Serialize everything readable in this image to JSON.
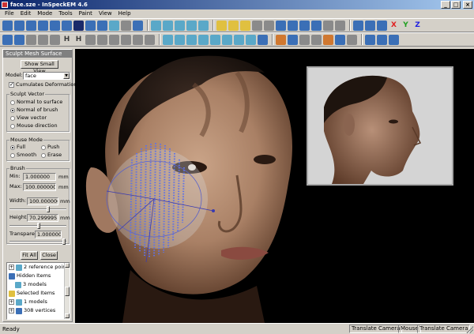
{
  "window": {
    "title": "face.sze - InSpeckEM 4.6"
  },
  "menu": [
    "File",
    "Edit",
    "Mode",
    "Tools",
    "Paint",
    "View",
    "Help"
  ],
  "toolbar1": {
    "axes": {
      "x": "X",
      "y": "Y",
      "z": "Z"
    },
    "axis_colors": {
      "x": "#e02020",
      "y": "#20a020",
      "z": "#2020e0"
    }
  },
  "toolbar2": {
    "h1": "H",
    "h2": "H"
  },
  "panel": {
    "title": "Sculpt Mesh Surface",
    "show_small_view": "Show Small View",
    "model_label": "Model:",
    "model_value": "face",
    "cumulates_deformation": "Cumulates Deformation",
    "sculpt_vector": {
      "title": "Sculpt Vector",
      "options": [
        "Normal to surface",
        "Normal of brush",
        "View vector",
        "Mouse direction"
      ],
      "selected_index": 1
    },
    "mouse_mode": {
      "title": "Mouse Mode",
      "options": [
        "Full",
        "Push",
        "Smooth",
        "Erase"
      ],
      "selected_index": 0
    },
    "brush": {
      "title": "Brush",
      "min_label": "Min:",
      "min_value": "1.000000",
      "min_unit": "mm",
      "max_label": "Max:",
      "max_value": "100.000000",
      "max_unit": "mm",
      "width_label": "Width:",
      "width_value": "100.000000",
      "width_unit": "mm",
      "height_label": "Height:",
      "height_value": "70.299995",
      "height_unit": "mm",
      "transparency_label": "Transparency:",
      "transparency_value": "1.000000"
    },
    "fit_all": "Fit All",
    "close": "Close",
    "tree": [
      {
        "pm": "+",
        "label": "2 reference point"
      },
      {
        "pm": "",
        "label": "Hidden Items"
      },
      {
        "pm": "+",
        "label": "3 models"
      },
      {
        "pm": "",
        "label": "Selected Items"
      },
      {
        "pm": "+",
        "label": "1 models"
      },
      {
        "pm": "+",
        "label": "308 vertices"
      }
    ]
  },
  "status": {
    "left": "Ready",
    "cells": [
      "Translate Camera",
      "Mouse",
      "Translate Camera"
    ]
  }
}
